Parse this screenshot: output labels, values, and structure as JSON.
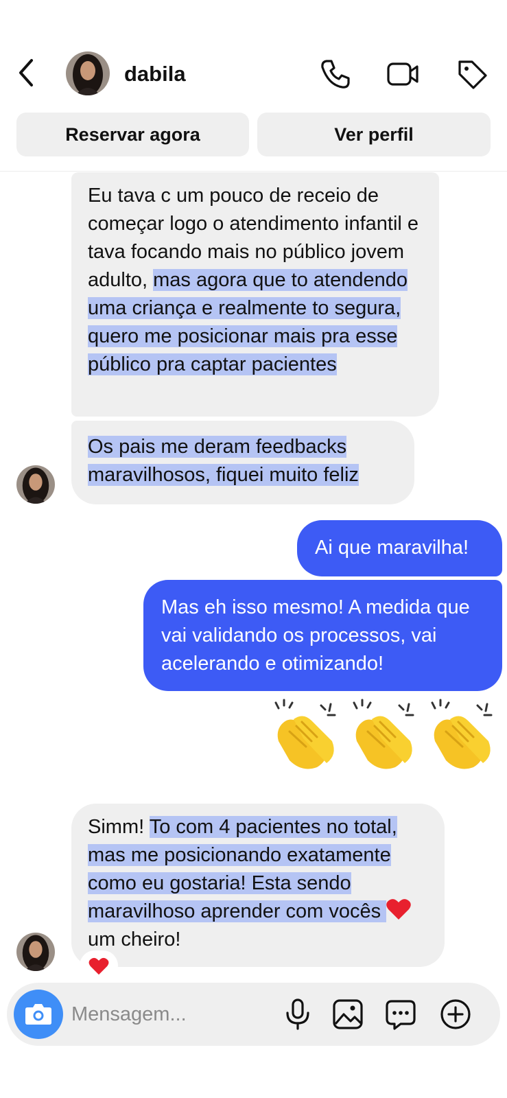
{
  "header": {
    "username": "dabila",
    "icons": [
      "back-chevron-icon",
      "phone-icon",
      "video-camera-icon",
      "tag-icon"
    ]
  },
  "actions": {
    "reserve_label": "Reservar agora",
    "profile_label": "Ver perfil"
  },
  "messages": [
    {
      "from": "contact",
      "segments": [
        {
          "text": "Eu tava c um pouco de receio de começar logo o atendimento infantil e tava focando mais no público jovem adulto, ",
          "highlight": false
        },
        {
          "text": "mas agora que to atendendo uma criança e realmente to segura, quero me posicionar mais pra esse público pra captar pacientes",
          "highlight": true
        }
      ]
    },
    {
      "from": "contact",
      "segments": [
        {
          "text": "Os pais me deram feedbacks maravilhosos, fiquei muito feliz",
          "highlight": true
        }
      ]
    },
    {
      "from": "me",
      "text": "Ai que maravilha!"
    },
    {
      "from": "me",
      "text": "Mas eh isso mesmo! A medida que vai validando os processos, vai acelerando e otimizando!"
    },
    {
      "from": "me",
      "emoji": "clapping-hands x3"
    },
    {
      "from": "contact",
      "segments": [
        {
          "text": "Simm! ",
          "highlight": false
        },
        {
          "text": "To com 4 pacientes no total, mas me posicionando exatamente como eu gostaria! Esta sendo maravilhoso aprender com vocês ",
          "highlight": true
        },
        {
          "emoji": "red-heart-icon"
        },
        {
          "text": " um cheiro!",
          "highlight": false
        }
      ],
      "reaction": "red-heart-icon"
    }
  ],
  "composer": {
    "placeholder": "Mensagem...",
    "icons": [
      "camera-icon",
      "microphone-icon",
      "image-icon",
      "sticker-icon",
      "plus-icon"
    ]
  },
  "colors": {
    "outgoing_bubble": "#3d5bf5",
    "incoming_bubble": "#efefef",
    "highlight": "#b5c4f4",
    "camera_button": "#3f8ef7",
    "heart": "#e8202e"
  }
}
